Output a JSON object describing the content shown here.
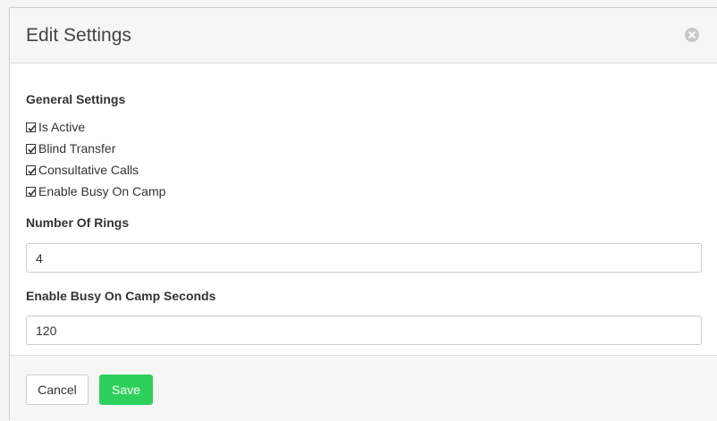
{
  "modal": {
    "title": "Edit Settings",
    "close_icon": "close-circle-icon"
  },
  "general_settings": {
    "heading": "General Settings",
    "options": [
      {
        "label": "Is Active",
        "checked": true
      },
      {
        "label": "Blind Transfer",
        "checked": true
      },
      {
        "label": "Consultative Calls",
        "checked": true
      },
      {
        "label": "Enable Busy On Camp",
        "checked": true
      }
    ]
  },
  "number_of_rings": {
    "label": "Number Of Rings",
    "value": "4"
  },
  "busy_on_camp_seconds": {
    "label": "Enable Busy On Camp Seconds",
    "value": "120"
  },
  "footer": {
    "cancel_label": "Cancel",
    "save_label": "Save"
  },
  "colors": {
    "save_button": "#2ed05c",
    "header_background": "#f6f6f6",
    "close_icon": "#c8c8c8"
  }
}
